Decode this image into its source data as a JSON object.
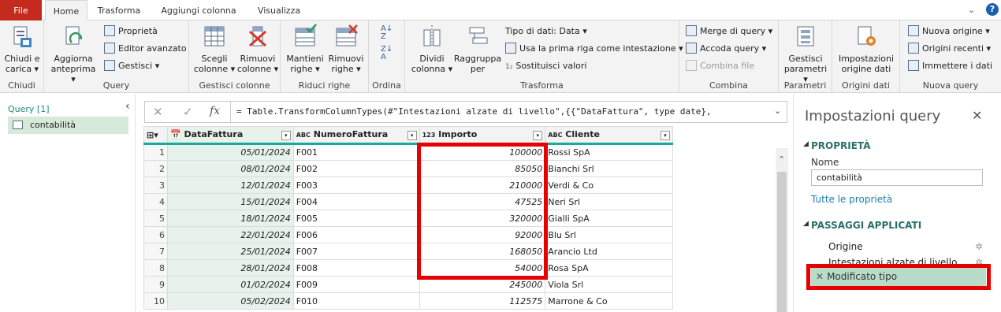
{
  "tabs": {
    "file": "File",
    "home": "Home",
    "transform": "Trasforma",
    "add_column": "Aggiungi colonna",
    "view": "Visualizza"
  },
  "ribbon": {
    "close_load": "Chiudi e carica",
    "close_load_l1": "Chiudi e",
    "close_load_l2": "carica ▾",
    "g_close": "Chiudi",
    "refresh_l1": "Aggiorna",
    "refresh_l2": "anteprima ▾",
    "properties": "Proprietà",
    "adv_editor": "Editor avanzato",
    "manage": "Gestisci ▾",
    "g_query": "Query",
    "choose_l1": "Scegli",
    "choose_l2": "colonne ▾",
    "remove_l1": "Rimuovi",
    "remove_l2": "colonne ▾",
    "g_manage_cols": "Gestisci colonne",
    "keep_l1": "Mantieni",
    "keep_l2": "righe ▾",
    "rmrows_l1": "Rimuovi",
    "rmrows_l2": "righe ▾",
    "g_reduce": "Riduci righe",
    "g_sort": "Ordina",
    "split_l1": "Dividi",
    "split_l2": "colonna ▾",
    "group_l1": "Raggruppa",
    "group_l2": "per",
    "datatype": "Tipo di dati: Data ▾",
    "first_row": "Usa la prima riga come intestazione ▾",
    "replace": "Sostituisci valori",
    "g_transform": "Trasforma",
    "merge": "Merge di query ▾",
    "append": "Accoda query ▾",
    "combine": "Combina file",
    "g_combine": "Combina",
    "params_l1": "Gestisci",
    "params_l2": "parametri ▾",
    "g_params": "Parametri",
    "ds_l1": "Impostazioni",
    "ds_l2": "origine dati",
    "g_ds": "Origini dati",
    "new_source": "Nuova origine ▾",
    "recent": "Origini recenti ▾",
    "enter": "Immettere i dati",
    "g_newq": "Nuova query"
  },
  "queries": {
    "header": "Query [1]",
    "item": "contabilità"
  },
  "formula": "= Table.TransformColumnTypes(#\"Intestazioni alzate di livello\",{{\"DataFattura\", type date},",
  "columns": [
    {
      "type": "📅",
      "name": "DataFattura"
    },
    {
      "type": "ABC",
      "name": "NumeroFattura"
    },
    {
      "type": "123",
      "name": "Importo"
    },
    {
      "type": "ABC",
      "name": "Cliente"
    }
  ],
  "rows": [
    {
      "n": "1",
      "date": "05/01/2024",
      "num": "F001",
      "imp": "100000",
      "cli": "Rossi SpA"
    },
    {
      "n": "2",
      "date": "08/01/2024",
      "num": "F002",
      "imp": "85050",
      "cli": "Bianchi Srl"
    },
    {
      "n": "3",
      "date": "12/01/2024",
      "num": "F003",
      "imp": "210000",
      "cli": "Verdi & Co"
    },
    {
      "n": "4",
      "date": "15/01/2024",
      "num": "F004",
      "imp": "47525",
      "cli": "Neri Srl"
    },
    {
      "n": "5",
      "date": "18/01/2024",
      "num": "F005",
      "imp": "320000",
      "cli": "Gialli SpA"
    },
    {
      "n": "6",
      "date": "22/01/2024",
      "num": "F006",
      "imp": "92000",
      "cli": "Blu Srl"
    },
    {
      "n": "7",
      "date": "25/01/2024",
      "num": "F007",
      "imp": "168050",
      "cli": "Arancio Ltd"
    },
    {
      "n": "8",
      "date": "28/01/2024",
      "num": "F008",
      "imp": "54000",
      "cli": "Rosa SpA"
    },
    {
      "n": "9",
      "date": "01/02/2024",
      "num": "F009",
      "imp": "245000",
      "cli": "Viola Srl"
    },
    {
      "n": "10",
      "date": "05/02/2024",
      "num": "F010",
      "imp": "112575",
      "cli": "Marrone & Co"
    }
  ],
  "settings": {
    "title": "Impostazioni query",
    "props": "PROPRIETÀ",
    "name_label": "Nome",
    "name_value": "contabilità",
    "all_props": "Tutte le proprietà",
    "steps_title": "PASSAGGI APPLICATI",
    "steps": [
      "Origine",
      "Intestazioni alzate di livello",
      "Modificato tipo"
    ]
  },
  "colors": {
    "accent": "#1ba8a0",
    "file_tab": "#c42b1c",
    "highlight": "#e60000",
    "step_selected": "#b9dcc8"
  }
}
